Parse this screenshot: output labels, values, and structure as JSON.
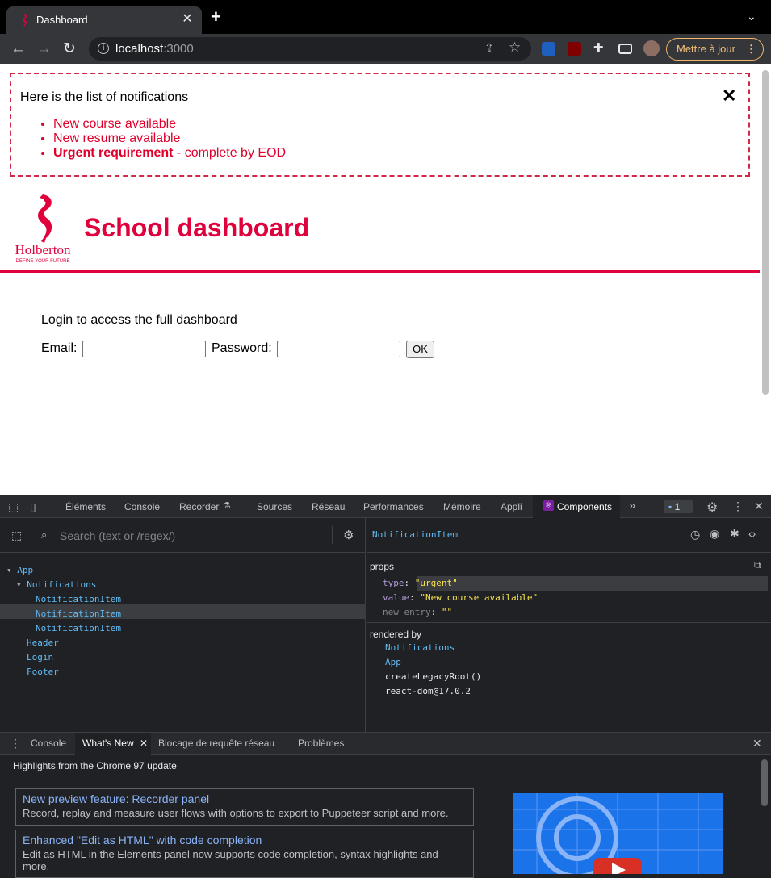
{
  "browser": {
    "tab_title": "Dashboard",
    "tab_close": "✕",
    "new_tab": "+",
    "tab_menu": "⌄",
    "url_host": "localhost",
    "url_port": ":3000",
    "update_label": "Mettre à jour"
  },
  "page": {
    "notifications": {
      "title": "Here is the list of notifications",
      "close": "✕",
      "items": [
        {
          "text": "New course available",
          "type": "default"
        },
        {
          "text": "New resume available",
          "type": "default"
        },
        {
          "strong": "Urgent requirement",
          "rest": " - complete by EOD",
          "type": "urgent"
        }
      ]
    },
    "logo": {
      "name": "Holberton",
      "tagline": "DEFINE YOUR FUTURE"
    },
    "header_title": "School dashboard",
    "login": {
      "text": "Login to access the full dashboard",
      "email_label": "Email:",
      "password_label": "Password:",
      "ok_label": "OK",
      "email_value": "",
      "password_value": ""
    }
  },
  "devtools": {
    "tabs": [
      "Éléments",
      "Console",
      "Recorder",
      "Sources",
      "Réseau",
      "Performances",
      "Mémoire",
      "Appli"
    ],
    "active_tab": "Components",
    "more": "»",
    "message_count": "1",
    "components": {
      "search_placeholder": "Search (text or /regex/)",
      "tree": [
        {
          "label": "App",
          "arrow": "▾"
        },
        {
          "label": "Notifications",
          "arrow": "▾"
        },
        {
          "label": "NotificationItem",
          "selected": true
        },
        {
          "label": "NotificationItem"
        },
        {
          "label": "NotificationItem"
        },
        {
          "label": "Header"
        },
        {
          "label": "Login"
        },
        {
          "label": "Footer"
        }
      ],
      "selected_name": "NotificationItem",
      "props_heading": "props",
      "props": [
        {
          "key": "type",
          "value": "\"urgent\""
        },
        {
          "key": "value",
          "value": "\"New course available\""
        }
      ],
      "new_entry_key": "new entry",
      "new_entry_value": "\"\"",
      "rendered_by_heading": "rendered by",
      "rendered_by": [
        "Notifications",
        "App",
        "createLegacyRoot()",
        "react-dom@17.0.2"
      ]
    },
    "drawer": {
      "tabs": [
        "Console",
        "What's New",
        "Blocage de requête réseau",
        "Problèmes"
      ],
      "active": "What's New",
      "highlights": "Highlights from the Chrome 97 update",
      "cards": [
        {
          "title": "New preview feature: Recorder panel",
          "desc": "Record, replay and measure user flows with options to export to Puppeteer script and more."
        },
        {
          "title": "Enhanced \"Edit as HTML\" with code completion",
          "desc": "Edit as HTML in the Elements panel now supports code completion, syntax highlights and more."
        }
      ]
    }
  }
}
